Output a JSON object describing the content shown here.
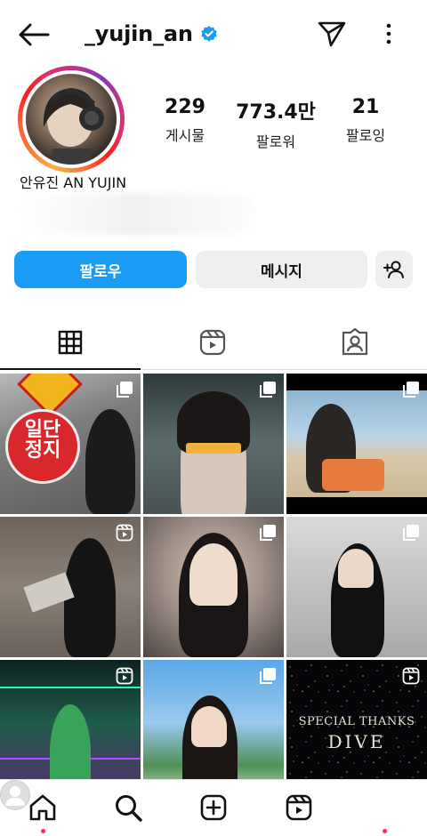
{
  "header": {
    "username": "_yujin_an",
    "verified": true,
    "icons": [
      "back-arrow-icon",
      "verified-badge-icon",
      "send-icon",
      "more-options-icon"
    ]
  },
  "profile": {
    "display_name": "안유진 AN YUJIN",
    "stats": [
      {
        "value": "229",
        "label": "게시물"
      },
      {
        "value": "773.4만",
        "label": "팔로워"
      },
      {
        "value": "21",
        "label": "팔로잉"
      }
    ]
  },
  "actions": {
    "follow_label": "팔로우",
    "message_label": "메시지",
    "suggest_icon": "add-person-icon"
  },
  "colors": {
    "follow_button": "#1a9bf6",
    "secondary_button": "#efefef",
    "verified_blue": "#1a9bf6",
    "notification_dot": "#ff2d55"
  },
  "tabs": [
    {
      "id": "grid",
      "icon": "grid-icon",
      "active": true
    },
    {
      "id": "reels",
      "icon": "reels-icon",
      "active": false
    },
    {
      "id": "tagged",
      "icon": "tagged-person-icon",
      "active": false
    }
  ],
  "grid": {
    "posts": [
      {
        "type": "carousel",
        "text": "일단 정지"
      },
      {
        "type": "carousel"
      },
      {
        "type": "carousel"
      },
      {
        "type": "reel"
      },
      {
        "type": "carousel"
      },
      {
        "type": "carousel"
      },
      {
        "type": "reel"
      },
      {
        "type": "carousel"
      },
      {
        "type": "reel",
        "text_line1": "SPECIAL THANKS",
        "text_line2": "DIVE"
      }
    ]
  },
  "bottom_nav": [
    {
      "icon": "home-icon",
      "active": true
    },
    {
      "icon": "search-icon",
      "active": false
    },
    {
      "icon": "create-icon",
      "active": false
    },
    {
      "icon": "reels-icon",
      "active": false
    },
    {
      "icon": "profile-avatar",
      "active": false
    }
  ]
}
